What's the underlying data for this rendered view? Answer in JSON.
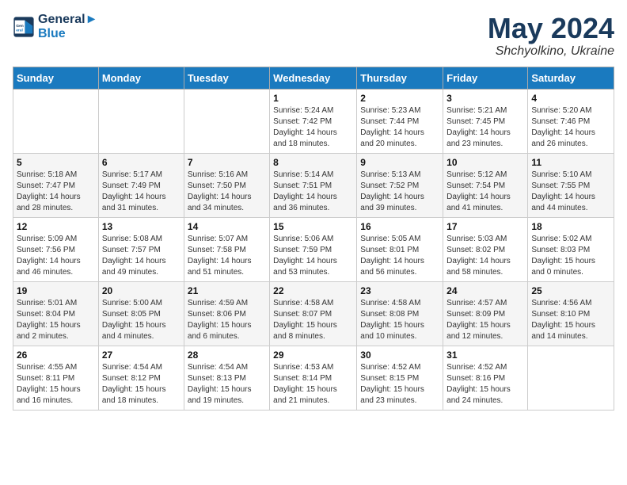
{
  "logo": {
    "line1": "General",
    "line2": "Blue"
  },
  "title": "May 2024",
  "location": "Shchyolkino, Ukraine",
  "days_header": [
    "Sunday",
    "Monday",
    "Tuesday",
    "Wednesday",
    "Thursday",
    "Friday",
    "Saturday"
  ],
  "weeks": [
    [
      {
        "num": "",
        "info": ""
      },
      {
        "num": "",
        "info": ""
      },
      {
        "num": "",
        "info": ""
      },
      {
        "num": "1",
        "info": "Sunrise: 5:24 AM\nSunset: 7:42 PM\nDaylight: 14 hours\nand 18 minutes."
      },
      {
        "num": "2",
        "info": "Sunrise: 5:23 AM\nSunset: 7:44 PM\nDaylight: 14 hours\nand 20 minutes."
      },
      {
        "num": "3",
        "info": "Sunrise: 5:21 AM\nSunset: 7:45 PM\nDaylight: 14 hours\nand 23 minutes."
      },
      {
        "num": "4",
        "info": "Sunrise: 5:20 AM\nSunset: 7:46 PM\nDaylight: 14 hours\nand 26 minutes."
      }
    ],
    [
      {
        "num": "5",
        "info": "Sunrise: 5:18 AM\nSunset: 7:47 PM\nDaylight: 14 hours\nand 28 minutes."
      },
      {
        "num": "6",
        "info": "Sunrise: 5:17 AM\nSunset: 7:49 PM\nDaylight: 14 hours\nand 31 minutes."
      },
      {
        "num": "7",
        "info": "Sunrise: 5:16 AM\nSunset: 7:50 PM\nDaylight: 14 hours\nand 34 minutes."
      },
      {
        "num": "8",
        "info": "Sunrise: 5:14 AM\nSunset: 7:51 PM\nDaylight: 14 hours\nand 36 minutes."
      },
      {
        "num": "9",
        "info": "Sunrise: 5:13 AM\nSunset: 7:52 PM\nDaylight: 14 hours\nand 39 minutes."
      },
      {
        "num": "10",
        "info": "Sunrise: 5:12 AM\nSunset: 7:54 PM\nDaylight: 14 hours\nand 41 minutes."
      },
      {
        "num": "11",
        "info": "Sunrise: 5:10 AM\nSunset: 7:55 PM\nDaylight: 14 hours\nand 44 minutes."
      }
    ],
    [
      {
        "num": "12",
        "info": "Sunrise: 5:09 AM\nSunset: 7:56 PM\nDaylight: 14 hours\nand 46 minutes."
      },
      {
        "num": "13",
        "info": "Sunrise: 5:08 AM\nSunset: 7:57 PM\nDaylight: 14 hours\nand 49 minutes."
      },
      {
        "num": "14",
        "info": "Sunrise: 5:07 AM\nSunset: 7:58 PM\nDaylight: 14 hours\nand 51 minutes."
      },
      {
        "num": "15",
        "info": "Sunrise: 5:06 AM\nSunset: 7:59 PM\nDaylight: 14 hours\nand 53 minutes."
      },
      {
        "num": "16",
        "info": "Sunrise: 5:05 AM\nSunset: 8:01 PM\nDaylight: 14 hours\nand 56 minutes."
      },
      {
        "num": "17",
        "info": "Sunrise: 5:03 AM\nSunset: 8:02 PM\nDaylight: 14 hours\nand 58 minutes."
      },
      {
        "num": "18",
        "info": "Sunrise: 5:02 AM\nSunset: 8:03 PM\nDaylight: 15 hours\nand 0 minutes."
      }
    ],
    [
      {
        "num": "19",
        "info": "Sunrise: 5:01 AM\nSunset: 8:04 PM\nDaylight: 15 hours\nand 2 minutes."
      },
      {
        "num": "20",
        "info": "Sunrise: 5:00 AM\nSunset: 8:05 PM\nDaylight: 15 hours\nand 4 minutes."
      },
      {
        "num": "21",
        "info": "Sunrise: 4:59 AM\nSunset: 8:06 PM\nDaylight: 15 hours\nand 6 minutes."
      },
      {
        "num": "22",
        "info": "Sunrise: 4:58 AM\nSunset: 8:07 PM\nDaylight: 15 hours\nand 8 minutes."
      },
      {
        "num": "23",
        "info": "Sunrise: 4:58 AM\nSunset: 8:08 PM\nDaylight: 15 hours\nand 10 minutes."
      },
      {
        "num": "24",
        "info": "Sunrise: 4:57 AM\nSunset: 8:09 PM\nDaylight: 15 hours\nand 12 minutes."
      },
      {
        "num": "25",
        "info": "Sunrise: 4:56 AM\nSunset: 8:10 PM\nDaylight: 15 hours\nand 14 minutes."
      }
    ],
    [
      {
        "num": "26",
        "info": "Sunrise: 4:55 AM\nSunset: 8:11 PM\nDaylight: 15 hours\nand 16 minutes."
      },
      {
        "num": "27",
        "info": "Sunrise: 4:54 AM\nSunset: 8:12 PM\nDaylight: 15 hours\nand 18 minutes."
      },
      {
        "num": "28",
        "info": "Sunrise: 4:54 AM\nSunset: 8:13 PM\nDaylight: 15 hours\nand 19 minutes."
      },
      {
        "num": "29",
        "info": "Sunrise: 4:53 AM\nSunset: 8:14 PM\nDaylight: 15 hours\nand 21 minutes."
      },
      {
        "num": "30",
        "info": "Sunrise: 4:52 AM\nSunset: 8:15 PM\nDaylight: 15 hours\nand 23 minutes."
      },
      {
        "num": "31",
        "info": "Sunrise: 4:52 AM\nSunset: 8:16 PM\nDaylight: 15 hours\nand 24 minutes."
      },
      {
        "num": "",
        "info": ""
      }
    ]
  ]
}
